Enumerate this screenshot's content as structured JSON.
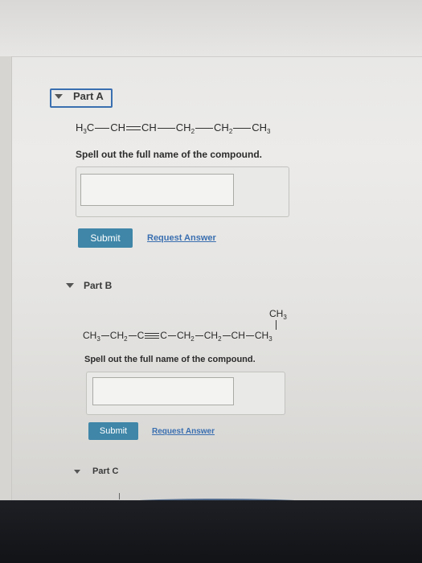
{
  "part_a": {
    "title": "Part A",
    "formula": {
      "h3c": "H",
      "h3c_sub": "3",
      "h3c_tail": "C",
      "ch1": "CH",
      "ch2": "CH",
      "ch3": "CH",
      "ch3_sub": "2",
      "ch4": "CH",
      "ch4_sub": "2",
      "ch5": "CH",
      "ch5_sub": "3"
    },
    "prompt": "Spell out the full name of the compound.",
    "submit_label": "Submit",
    "request_label": "Request Answer"
  },
  "part_b": {
    "title": "Part B",
    "branch": {
      "label": "CH",
      "sub": "3"
    },
    "formula": {
      "g1": "CH",
      "g1_sub": "3",
      "g2": "CH",
      "g2_sub": "2",
      "g3": "C",
      "g4": "C",
      "g5": "CH",
      "g5_sub": "2",
      "g6": "CH",
      "g6_sub": "2",
      "g7": "CH",
      "g8": "CH",
      "g8_sub": "3"
    },
    "prompt": "Spell out the full name of the compound.",
    "submit_label": "Submit",
    "request_label": "Request Answer"
  },
  "part_c": {
    "title": "Part C"
  },
  "colors": {
    "accent": "#3f86a8",
    "link": "#3a6fb0",
    "focus": "#3a6fb0"
  },
  "icons": {
    "collapse": "caret-down-icon"
  }
}
